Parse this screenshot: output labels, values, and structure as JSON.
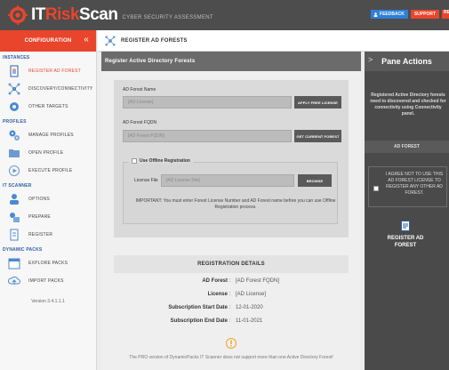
{
  "app": {
    "logo_it": "IT",
    "logo_risk": "Risk",
    "logo_scan": "Scan",
    "logo_sub": "CYBER SECURITY ASSESSMENT",
    "feedback_label": "FEEDBACK",
    "support_label": "SUPPORT",
    "cut_label": "RE"
  },
  "sidebar": {
    "header": "CONFIGURATION",
    "collapse_glyph": "«",
    "sections": [
      {
        "title": "INSTANCES",
        "items": [
          {
            "label": "REGISTER AD FOREST",
            "icon": "document-icon"
          },
          {
            "label": "DISCOVERY/CONNECTIVITY",
            "icon": "network-icon"
          },
          {
            "label": "OTHER TARGETS",
            "icon": "gear-icon"
          }
        ]
      },
      {
        "title": "PROFILES",
        "items": [
          {
            "label": "MANAGE PROFILES",
            "icon": "gears-icon"
          },
          {
            "label": "OPEN PROFILE",
            "icon": "folder-icon"
          },
          {
            "label": "EXECUTE PROFILE",
            "icon": "play-icon"
          }
        ]
      },
      {
        "title": "IT SCANNER",
        "items": [
          {
            "label": "OPTIONS",
            "icon": "user-icon"
          },
          {
            "label": "PREPARE",
            "icon": "prepare-icon"
          },
          {
            "label": "REGISTER",
            "icon": "register-icon"
          }
        ]
      },
      {
        "title": "DYNAMIC PACKS",
        "items": [
          {
            "label": "EXPLORE PACKS",
            "icon": "calendar-icon"
          },
          {
            "label": "IMPORT PACKS",
            "icon": "cloud-upload-icon"
          }
        ]
      }
    ],
    "version": "Version 3.4.1.1.1"
  },
  "main": {
    "header": "REGISTER AD FORESTS",
    "panel_title": "Register Active Directory Forests",
    "form": {
      "forest_name_label": "AD Forest Name",
      "forest_name_placeholder": "[AD License]",
      "apply_license_button": "APPLY FREE LICENSE",
      "forest_fqdn_label": "AD Forest FQDN",
      "forest_fqdn_placeholder": "[AD Forest FQDN]",
      "get_current_forest_button": "GET CURRENT FOREST",
      "offline_label": "Use Offline Registration",
      "license_file_label": "License File",
      "license_file_placeholder": "[AD License File]",
      "browse_button": "BROWSE",
      "note": "IMPORTANT: You must enter Forest License Number and AD Forest name before you can use Offline Registration process."
    },
    "registration": {
      "title": "REGISTRATION DETAILS",
      "rows": [
        {
          "key": "AD Forest",
          "value": "[AD Forest FQDN]"
        },
        {
          "key": "License",
          "value": "[AD License]"
        },
        {
          "key": "Subscription Start Date",
          "value": "12-01-2020"
        },
        {
          "key": "Subscription End Date",
          "value": "11-01-2021"
        }
      ]
    },
    "footer_note": "The PRO version of DynamicPacks IT Scanner does not support more than one Active Directory Forest!"
  },
  "pane": {
    "title": "Pane Actions",
    "description": "Registered Active Directory forests need to discovered and checked for connectivity using Connectivity panel.",
    "sub_header": "AD FOREST",
    "agree_text": "I AGREE NOT TO USE THIS AD FOREST LICENSE TO REGISTER ANY OTHER AD FOREST.",
    "register_label": "REGISTER AD FOREST"
  },
  "colors": {
    "accent": "#e8452c",
    "topbar": "#4d4d4d",
    "link_blue": "#2b5fa8",
    "pane_bg": "#4a4a4a"
  }
}
